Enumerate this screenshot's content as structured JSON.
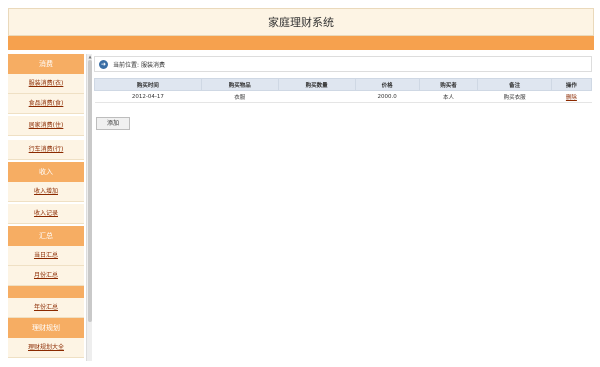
{
  "header": {
    "title": "家庭理财系统"
  },
  "sidebar": {
    "sections": [
      {
        "heading": "消费",
        "items": [
          "服装消费(衣)",
          "食品消费(食)",
          "居家消费(住)",
          "行车消费(行)"
        ]
      },
      {
        "heading": "收入",
        "items": [
          "收入增加",
          "收入记录"
        ]
      },
      {
        "heading": "汇总",
        "items": [
          "当日汇总",
          "月份汇总",
          "",
          "年份汇总"
        ]
      },
      {
        "heading": "理财规划",
        "items": [
          "理财规划大全"
        ]
      }
    ]
  },
  "breadcrumb": {
    "label": "当前位置:",
    "current": "服装消费"
  },
  "table": {
    "headers": [
      "购买时间",
      "购买物品",
      "购买数量",
      "价格",
      "购买者",
      "备注",
      "操作"
    ],
    "rows": [
      [
        "2012-04-17",
        "衣服",
        "",
        "2000.0",
        "本人",
        "购买衣服",
        "删除"
      ]
    ]
  },
  "actions": {
    "add_label": "添加"
  }
}
